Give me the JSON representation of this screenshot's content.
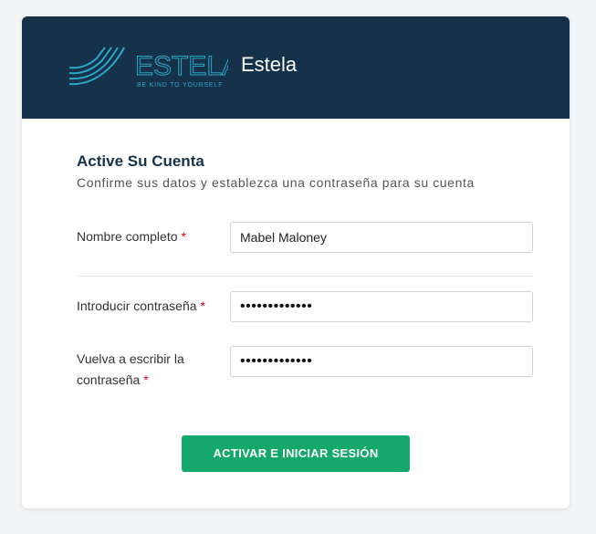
{
  "header": {
    "logo_text": "ESTELA",
    "logo_tagline": "BE KIND TO YOURSELF",
    "app_title": "Estela",
    "background": "#16324a"
  },
  "form": {
    "title": "Active Su Cuenta",
    "subtitle": "Confirme sus datos y establezca una contraseña para su cuenta",
    "fields": [
      {
        "label": "Nombre completo",
        "required_mark": "*",
        "value": "Mabel Maloney"
      },
      {
        "label": "Introducir contraseña",
        "required_mark": "*",
        "value": "•••••••••••••"
      },
      {
        "label_line1": "Vuelva a escribir la",
        "label_line2": "contraseña",
        "required_mark": "*",
        "value": "•••••••••••••"
      }
    ],
    "submit_label": "ACTIVAR E INICIAR SESIÓN"
  },
  "colors": {
    "accent": "#14a86b",
    "required": "#d0021b",
    "title": "#16324a"
  }
}
